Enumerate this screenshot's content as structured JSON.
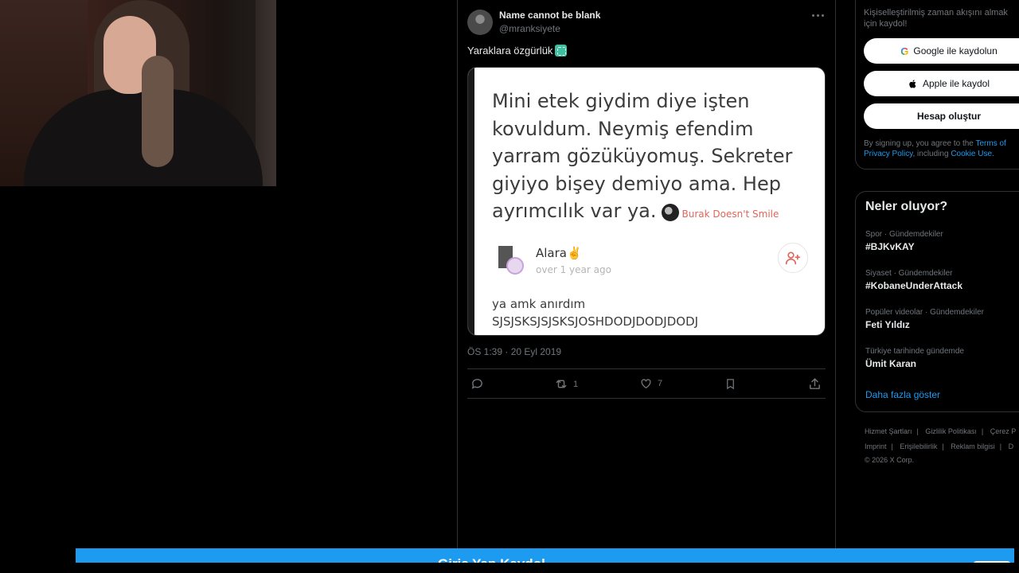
{
  "tweet": {
    "author_name": "Name cannot be blank",
    "author_handle": "@mranksiyete",
    "text": "Yaraklara özgürlük",
    "timestamp": "ÖS 1:39 · 20 Eyl 2019",
    "media": {
      "lines": [
        "Mini etek giydim diye işten",
        "kovuldum. Neymiş efendim",
        "yarram gözüküyomuş. Sekreter",
        "giyiyo bişey demiyo ama. Hep",
        "ayrımcılık var ya."
      ],
      "credit": "Burak Doesn't Smile",
      "commenter_name": "Alara✌️",
      "comment_time": "over 1 year ago",
      "comment_lines": [
        "ya amk anırdım",
        "SJSJSKSJSJSKSJOSHDODJDODJDODJ"
      ]
    },
    "actions": {
      "reply_icon": "reply-icon",
      "retweet_count": "1",
      "like_count": "7",
      "bookmark_icon": "bookmark-icon",
      "share_icon": "share-icon"
    }
  },
  "sidebar": {
    "signup": {
      "subtitle": "Kişiselleştirilmiş zaman akışını almak için kaydol!",
      "google_label": "Google ile kaydolun",
      "apple_label": "Apple ile kaydol",
      "create_label": "Hesap oluştur",
      "terms_prefix": "By signing up, you agree to the ",
      "terms_link": "Terms of",
      "privacy_link": "Privacy Policy",
      "terms_mid": ", including ",
      "cookie_link": "Cookie Use."
    },
    "trends": {
      "title": "Neler oluyor?",
      "items": [
        {
          "meta": "Spor · Gündemdekiler",
          "name": "#BJKvKAY"
        },
        {
          "meta": "Siyaset · Gündemdekiler",
          "name": "#KobaneUnderAttack"
        },
        {
          "meta": "Popüler videolar · Gündemdekiler",
          "name": "Feti Yıldız"
        },
        {
          "meta": "Türkiye tarihinde gündemde",
          "name": "Ümit Karan"
        }
      ],
      "show_more": "Daha fazla göster"
    },
    "footer": {
      "links_row1": [
        "Hizmet Şartları",
        "Gizlilik Politikası",
        "Çerez P"
      ],
      "links_row2": [
        "Imprint",
        "Erişilebilirlik",
        "Reklam bilgisi",
        "D"
      ],
      "copyright": "© 2026 X Corp."
    }
  },
  "banner": {
    "text": "Giriş Yap Kaydol"
  },
  "colors": {
    "accent": "#1d9bf0",
    "background": "#000000",
    "border": "#2f3336",
    "credit_red": "#e0655a"
  }
}
